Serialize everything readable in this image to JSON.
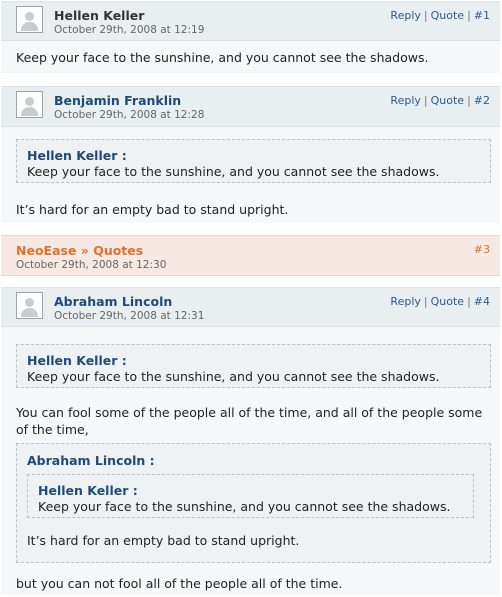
{
  "comments": [
    {
      "author": "Hellen Keller",
      "date": "October 29th, 2008 at 12:19",
      "reply": "Reply",
      "quote": "Quote",
      "number": "#1",
      "text": "Keep your face to the sunshine, and you cannot see the shadows."
    },
    {
      "author": "Benjamin Franklin",
      "date": "October 29th, 2008 at 12:28",
      "reply": "Reply",
      "quote": "Quote",
      "number": "#2",
      "quoted_author": "Hellen Keller :",
      "quoted_text": "Keep your face to the sunshine, and you cannot see the shadows.",
      "text": "It’s hard for an empty bad to stand upright."
    },
    {
      "author": "Abraham Lincoln",
      "date": "October 29th, 2008 at 12:31",
      "reply": "Reply",
      "quote": "Quote",
      "number": "#4",
      "quoted_author": "Hellen Keller :",
      "quoted_text": "Keep your face to the sunshine, and you cannot see the shadows.",
      "text": "You can fool some of the people all of the time, and all of the people some of the time,",
      "nested_quote": {
        "author": "Abraham Lincoln :",
        "inner_author": "Hellen Keller :",
        "inner_text": "Keep your face to the sunshine, and you cannot see the shadows.",
        "text": "It’s hard for an empty bad to stand upright."
      },
      "closing_text": "but you can not fool all of the people all of the time."
    }
  ],
  "pingback": {
    "title": "NeoEase » Quotes",
    "date": "October 29th, 2008 at 12:30",
    "number": "#3"
  },
  "actions_separator": "|"
}
